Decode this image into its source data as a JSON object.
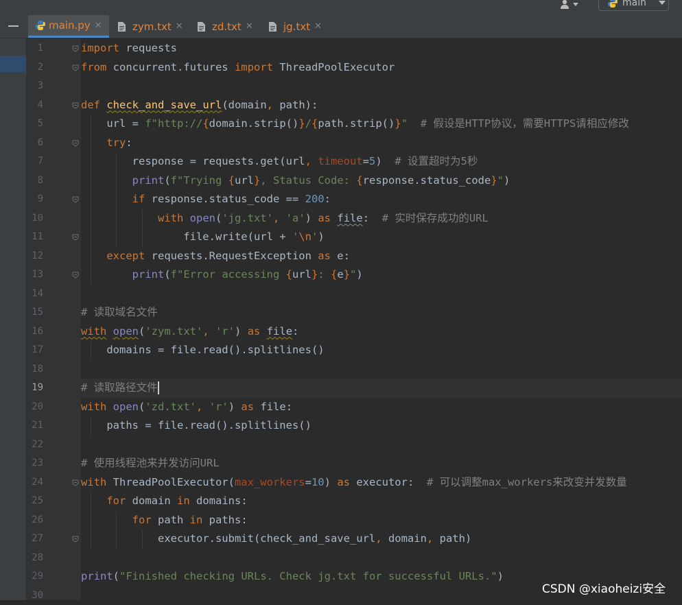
{
  "toolbar": {
    "user_icon": "user-icon",
    "branch_label": "main"
  },
  "tabs": [
    {
      "label": "main.py",
      "icon": "python-file-icon",
      "active": true
    },
    {
      "label": "zym.txt",
      "icon": "text-file-icon",
      "active": false
    },
    {
      "label": "zd.txt",
      "icon": "text-file-icon",
      "active": false
    },
    {
      "label": "jg.txt",
      "icon": "text-file-icon",
      "active": false
    }
  ],
  "tab_close_glyph": "✕",
  "editor": {
    "language": "python",
    "current_line": 19,
    "lines": [
      "import requests",
      "from concurrent.futures import ThreadPoolExecutor",
      "",
      "def check_and_save_url(domain, path):",
      "    url = f\"http://{domain.strip()}/{path.strip()}\"  # 假设是HTTP协议，需要HTTPS请相应修改",
      "    try:",
      "        response = requests.get(url, timeout=5)  # 设置超时为5秒",
      "        print(f\"Trying {url}, Status Code: {response.status_code}\")",
      "        if response.status_code == 200:",
      "            with open('jg.txt', 'a') as file:  # 实时保存成功的URL",
      "                file.write(url + '\\n')",
      "    except requests.RequestException as e:",
      "        print(f\"Error accessing {url}: {e}\")",
      "",
      "# 读取域名文件",
      "with open('zym.txt', 'r') as file:",
      "    domains = file.read().splitlines()",
      "",
      "# 读取路径文件",
      "with open('zd.txt', 'r') as file:",
      "    paths = file.read().splitlines()",
      "",
      "# 使用线程池来并发访问URL",
      "with ThreadPoolExecutor(max_workers=10) as executor:  # 可以调整max_workers来改变并发数量",
      "    for domain in domains:",
      "        for path in paths:",
      "            executor.submit(check_and_save_url, domain, path)",
      "",
      "print(\"Finished checking URLs. Check jg.txt for successful URLs.\")",
      ""
    ]
  },
  "watermark": "CSDN @xiaoheizi安全",
  "colors": {
    "background": "#2b2b2b",
    "keyword": "#cc7832",
    "string": "#6a8759",
    "number": "#6897bb",
    "comment": "#808080",
    "builtin": "#8888c6",
    "function_def": "#ffc66d",
    "parameter": "#aa4926",
    "tab_modified": "#e2843a"
  }
}
